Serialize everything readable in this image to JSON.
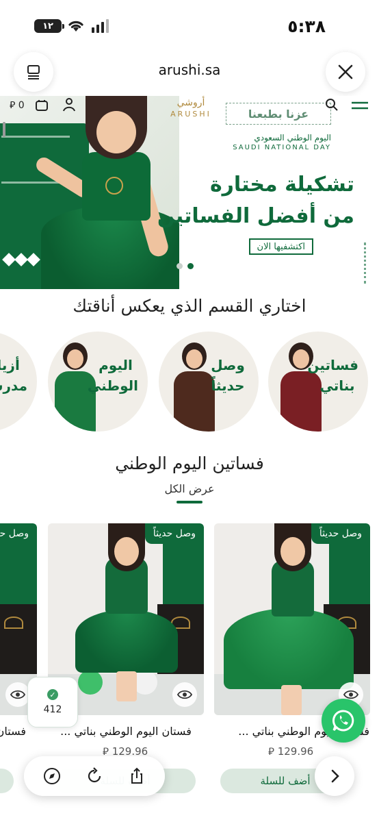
{
  "status_bar": {
    "time": "٥:٣٨",
    "battery": "١٢"
  },
  "browser": {
    "url": "arushi.sa"
  },
  "site_header": {
    "cart_price": "0",
    "currency_symbol": "⃁",
    "logo_ar": "أروشي",
    "logo_en": "ARUSHI",
    "tagline": "عزنا بطبعنا"
  },
  "hero": {
    "national_day_ar": "اليوم الوطني السعودي",
    "national_day_en": "SAUDI NATIONAL DAY",
    "title_line1": "تشكيلة مختارة",
    "title_line2": "من أفضل الفساتين",
    "cta": "اكتشفيها الان",
    "slides_total": 2,
    "active_slide": 2
  },
  "categories": {
    "title": "اختاري القسم الذي يعكس أناقتك",
    "items": [
      {
        "label": "فساتين بناتي",
        "color": "#7a1f24"
      },
      {
        "label": "وصل حديثاً",
        "color": "#4e2a1e"
      },
      {
        "label": "اليوم الوطني",
        "color": "#1a7a40"
      },
      {
        "label": "أزياء مدرسية",
        "color": "#0f3e6b"
      }
    ]
  },
  "products": {
    "title": "فساتين اليوم الوطني",
    "view_all": "عرض الكل",
    "items": [
      {
        "badge": "وصل حديثاً",
        "name": "فستان اليوم الوطني بناتي ...",
        "price": "129.96",
        "add_to_cart": "أضف للسلة"
      },
      {
        "badge": "وصل حديثاً",
        "name": "فستان اليوم الوطني بناتي ...",
        "price": "129.96",
        "add_to_cart": "أضف للسلة"
      },
      {
        "badge": "وصل حديثاً",
        "name": "فستان اليوم الوطني ...",
        "price": "",
        "add_to_cart": ""
      }
    ]
  },
  "overlays": {
    "views_count": "412"
  },
  "colors": {
    "brand_green": "#0f6a3b",
    "gold": "#b08a3e",
    "whatsapp": "#29c46a"
  }
}
